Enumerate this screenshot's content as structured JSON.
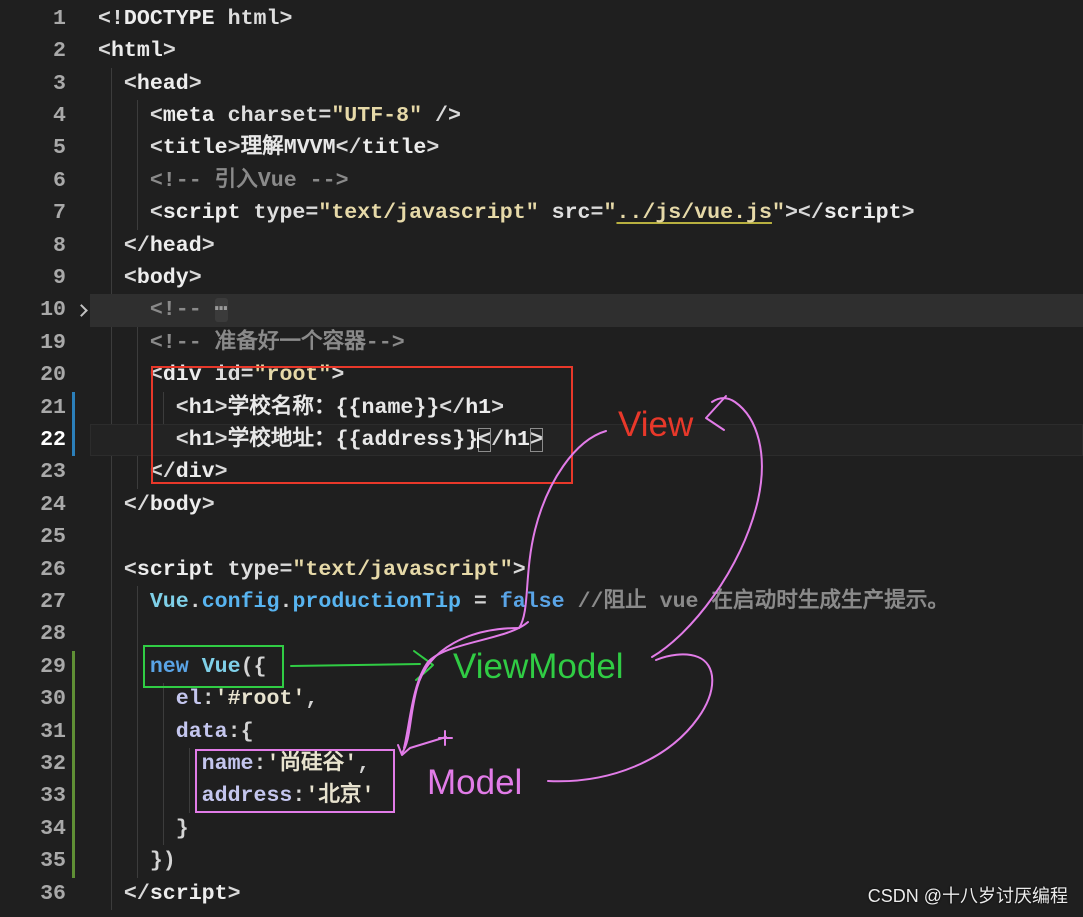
{
  "editor": {
    "lines": [
      {
        "num": "1",
        "tokens": [
          {
            "p": "<!"
          },
          {
            "tag": "DOCTYPE"
          },
          {
            "t": " "
          },
          {
            "attr": "html"
          },
          {
            "p": ">"
          }
        ]
      },
      {
        "num": "2",
        "tokens": [
          {
            "p": "<"
          },
          {
            "tag": "html"
          },
          {
            "p": ">"
          }
        ]
      },
      {
        "num": "3",
        "tokens": [
          {
            "ws": "  "
          },
          {
            "p": "<"
          },
          {
            "tag": "head"
          },
          {
            "p": ">"
          }
        ]
      },
      {
        "num": "4",
        "tokens": [
          {
            "ws": "    "
          },
          {
            "p": "<"
          },
          {
            "tag": "meta"
          },
          {
            "t": " "
          },
          {
            "attr": "charset"
          },
          {
            "p": "="
          },
          {
            "str": "\"UTF-8\""
          },
          {
            "t": " "
          },
          {
            "p": "/>"
          }
        ]
      },
      {
        "num": "5",
        "tokens": [
          {
            "ws": "    "
          },
          {
            "p": "<"
          },
          {
            "tag": "title"
          },
          {
            "p": ">"
          },
          {
            "t": "理解MVVM"
          },
          {
            "p": "</"
          },
          {
            "tag": "title"
          },
          {
            "p": ">"
          }
        ]
      },
      {
        "num": "6",
        "tokens": [
          {
            "ws": "    "
          },
          {
            "cm": "<!-- 引入Vue -->"
          }
        ]
      },
      {
        "num": "7",
        "tokens": [
          {
            "ws": "    "
          },
          {
            "p": "<"
          },
          {
            "tag": "script"
          },
          {
            "t": " "
          },
          {
            "attr": "type"
          },
          {
            "p": "="
          },
          {
            "str": "\"text/javascript\""
          },
          {
            "t": " "
          },
          {
            "attr": "src"
          },
          {
            "p": "="
          },
          {
            "str": "\""
          },
          {
            "link": "../js/vue.js"
          },
          {
            "str": "\""
          },
          {
            "p": ">"
          },
          {
            "p": "</"
          },
          {
            "tag": "script"
          },
          {
            "p": ">"
          }
        ]
      },
      {
        "num": "8",
        "tokens": [
          {
            "ws": "  "
          },
          {
            "p": "</"
          },
          {
            "tag": "head"
          },
          {
            "p": ">"
          }
        ]
      },
      {
        "num": "9",
        "tokens": [
          {
            "ws": "  "
          },
          {
            "p": "<"
          },
          {
            "tag": "body"
          },
          {
            "p": ">"
          }
        ]
      },
      {
        "num": "10",
        "folded": true,
        "fold_icon": "chevron-right-icon",
        "tokens": [
          {
            "ws": "    "
          },
          {
            "cm": "<!-- "
          },
          {
            "fold": "⋯"
          }
        ]
      },
      {
        "num": "19",
        "tokens": [
          {
            "ws": "    "
          },
          {
            "cm": "<!-- 准备好一个容器-->"
          }
        ]
      },
      {
        "num": "20",
        "tokens": [
          {
            "ws": "    "
          },
          {
            "p": "<"
          },
          {
            "tag": "div"
          },
          {
            "t": " "
          },
          {
            "attr": "id"
          },
          {
            "p": "="
          },
          {
            "str": "\"root\""
          },
          {
            "p": ">"
          }
        ]
      },
      {
        "num": "21",
        "modified": true,
        "tokens": [
          {
            "ws": "      "
          },
          {
            "p": "<"
          },
          {
            "tag": "h1"
          },
          {
            "p": ">"
          },
          {
            "t": "学校名称："
          },
          {
            "t": "{{name}}"
          },
          {
            "p": "</"
          },
          {
            "tag": "h1"
          },
          {
            "p": ">"
          }
        ]
      },
      {
        "num": "22",
        "modified": true,
        "current": true,
        "tokens": [
          {
            "ws": "      "
          },
          {
            "p": "<"
          },
          {
            "tag": "h1"
          },
          {
            "p": ">"
          },
          {
            "t": "学校地址："
          },
          {
            "t": "{{address}}"
          },
          {
            "pmc": "<"
          },
          {
            "p": "/"
          },
          {
            "tag": "h1"
          },
          {
            "pm": ">"
          }
        ]
      },
      {
        "num": "23",
        "tokens": [
          {
            "ws": "    "
          },
          {
            "p": "</"
          },
          {
            "tag": "div"
          },
          {
            "p": ">"
          }
        ]
      },
      {
        "num": "24",
        "tokens": [
          {
            "ws": "  "
          },
          {
            "p": "</"
          },
          {
            "tag": "body"
          },
          {
            "p": ">"
          }
        ]
      },
      {
        "num": "25",
        "tokens": []
      },
      {
        "num": "26",
        "tokens": [
          {
            "ws": "  "
          },
          {
            "p": "<"
          },
          {
            "tag": "script"
          },
          {
            "t": " "
          },
          {
            "attr": "type"
          },
          {
            "p": "="
          },
          {
            "str": "\"text/javascript\""
          },
          {
            "p": ">"
          }
        ]
      },
      {
        "num": "27",
        "tokens": [
          {
            "ws": "    "
          },
          {
            "cls": "Vue"
          },
          {
            "op": "."
          },
          {
            "prop": "config"
          },
          {
            "op": "."
          },
          {
            "prop": "productionTip"
          },
          {
            "op": " = "
          },
          {
            "kw": "false"
          },
          {
            "t": " "
          },
          {
            "cm": "//阻止 vue 在启动时生成生产提示。"
          }
        ]
      },
      {
        "num": "28",
        "tokens": []
      },
      {
        "num": "29",
        "added": true,
        "tokens": [
          {
            "ws": "    "
          },
          {
            "kw": "new"
          },
          {
            "t": " "
          },
          {
            "cls": "Vue"
          },
          {
            "op": "({"
          }
        ]
      },
      {
        "num": "30",
        "added": true,
        "tokens": [
          {
            "ws": "      "
          },
          {
            "key": "el"
          },
          {
            "op": ":"
          },
          {
            "js": "'#root'"
          },
          {
            "op": ","
          }
        ]
      },
      {
        "num": "31",
        "added": true,
        "tokens": [
          {
            "ws": "      "
          },
          {
            "key": "data"
          },
          {
            "op": ":{"
          }
        ]
      },
      {
        "num": "32",
        "added": true,
        "tokens": [
          {
            "ws": "        "
          },
          {
            "key": "name"
          },
          {
            "op": ":"
          },
          {
            "js": "'尚硅谷'"
          },
          {
            "op": ","
          }
        ]
      },
      {
        "num": "33",
        "added": true,
        "tokens": [
          {
            "ws": "        "
          },
          {
            "key": "address"
          },
          {
            "op": ":"
          },
          {
            "js": "'北京'"
          }
        ]
      },
      {
        "num": "34",
        "added": true,
        "tokens": [
          {
            "ws": "      "
          },
          {
            "op": "}"
          }
        ]
      },
      {
        "num": "35",
        "added": true,
        "tokens": [
          {
            "ws": "    "
          },
          {
            "op": "})"
          }
        ]
      },
      {
        "num": "36",
        "tokens": [
          {
            "ws": "  "
          },
          {
            "p": "</"
          },
          {
            "tag": "script"
          },
          {
            "p": ">"
          }
        ]
      }
    ]
  },
  "annotations": {
    "view_label": "View",
    "viewmodel_label": "ViewModel",
    "model_label": "Model",
    "colors": {
      "view": "#e8382a",
      "viewmodel": "#30cc44",
      "model": "#e27ce8"
    }
  },
  "watermark": "CSDN @十八岁讨厌编程"
}
